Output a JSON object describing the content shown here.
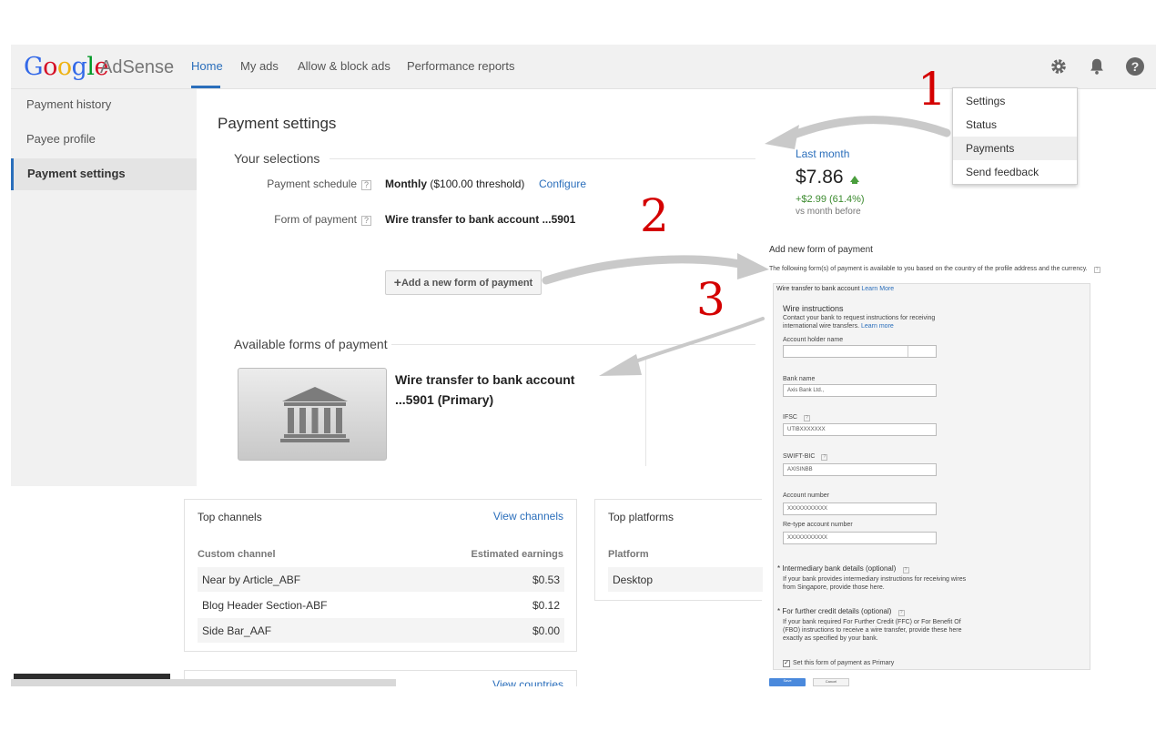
{
  "header": {
    "logo_letters": [
      "G",
      "o",
      "o",
      "g",
      "l",
      "e"
    ],
    "product": "AdSense",
    "tabs": [
      {
        "label": "Home"
      },
      {
        "label": "My ads"
      },
      {
        "label": "Allow & block ads"
      },
      {
        "label": "Performance reports"
      }
    ],
    "icons": [
      "gear-icon",
      "bell-icon",
      "help-icon"
    ],
    "help_glyph": "?",
    "colors": {
      "accent": "#2a6ebb",
      "header_bg": "#f1f1f1"
    }
  },
  "sidebar": {
    "items": [
      {
        "label": "Payment history"
      },
      {
        "label": "Payee profile"
      },
      {
        "label": "Payment settings",
        "active": true
      }
    ]
  },
  "main": {
    "title": "Payment settings",
    "your_selections": "Your selections",
    "question_mark": "?",
    "payment_schedule": {
      "label": "Payment schedule",
      "value": "Monthly",
      "threshold": "($100.00 threshold)",
      "link": "Configure"
    },
    "form_of_payment": {
      "label": "Form of payment",
      "value": "Wire transfer to bank account ...5901"
    },
    "add_button": {
      "plus": "+",
      "label": "Add a new form of payment"
    },
    "available_title": "Available forms of payment",
    "bank_line1": "Wire transfer to bank account",
    "bank_line2": "...5901 (Primary)"
  },
  "earnings": {
    "label": "Last month",
    "value": "$7.86",
    "change": "+$2.99 (61.4%)",
    "sub": "vs month before",
    "trend": "up"
  },
  "gear_menu": {
    "items": [
      {
        "label": "Settings"
      },
      {
        "label": "Status"
      },
      {
        "label": "Payments",
        "highlighted": true
      },
      {
        "label": "Send feedback"
      }
    ]
  },
  "annotations": {
    "one": "1",
    "two": "2",
    "three": "3",
    "arrow_color": "#c9c9c9",
    "number_color": "#d40000"
  },
  "top_channels": {
    "title": "Top channels",
    "link": "View channels",
    "col_channel": "Custom channel",
    "col_earnings": "Estimated earnings",
    "rows": [
      {
        "name": "Near by Article_ABF",
        "earnings": "$0.53"
      },
      {
        "name": "Blog Header Section-ABF",
        "earnings": "$0.12"
      },
      {
        "name": "Side Bar_AAF",
        "earnings": "$0.00"
      }
    ],
    "next_link": "View countries"
  },
  "top_platforms": {
    "title": "Top platforms",
    "col_platform": "Platform",
    "rows": [
      {
        "name": "Desktop"
      }
    ]
  },
  "payment_form": {
    "title": "Add new form of payment",
    "note": "The following form(s) of payment is available to you based on the country of the profile address and the currency.",
    "question_mark": "?",
    "tab_label": "Wire transfer to bank account",
    "tab_link": "Learn More",
    "wire_heading": "Wire instructions",
    "wire_text1": "Contact your bank to request instructions for receiving",
    "wire_text2": "international wire transfers.",
    "wire_link": "Learn more",
    "account_holder_label": "Account holder name",
    "bank_name_label": "Bank name",
    "bank_name_value": "Axis Bank Ltd.,",
    "ifsc_label": "IFSC",
    "ifsc_value": "UTIBXXXXXXX",
    "swift_label": "SWIFT-BIC",
    "swift_value": "AXISINBB",
    "account_number_label": "Account number",
    "account_number_value": "XXXXXXXXXXX",
    "retype_label": "Re-type account number",
    "retype_value": "XXXXXXXXXXX",
    "intermediary_title": "Intermediary bank details (optional)",
    "intermediary_text1": "If your bank provides intermediary instructions for receiving wires",
    "intermediary_text2": "from Singapore, provide those here.",
    "ffc_title": "For further credit details (optional)",
    "ffc_text1": "If your bank required For Further Credit (FFC) or For Benefit Of",
    "ffc_text2": "(FBO) instructions to receive a wire transfer, provide these here",
    "ffc_text3": "exactly as specified by your bank.",
    "bullet": "*",
    "primary_checkbox_label": "Set this form of payment as Primary",
    "primary_checked": true,
    "save_label": "Save",
    "cancel_label": "Cancel"
  }
}
